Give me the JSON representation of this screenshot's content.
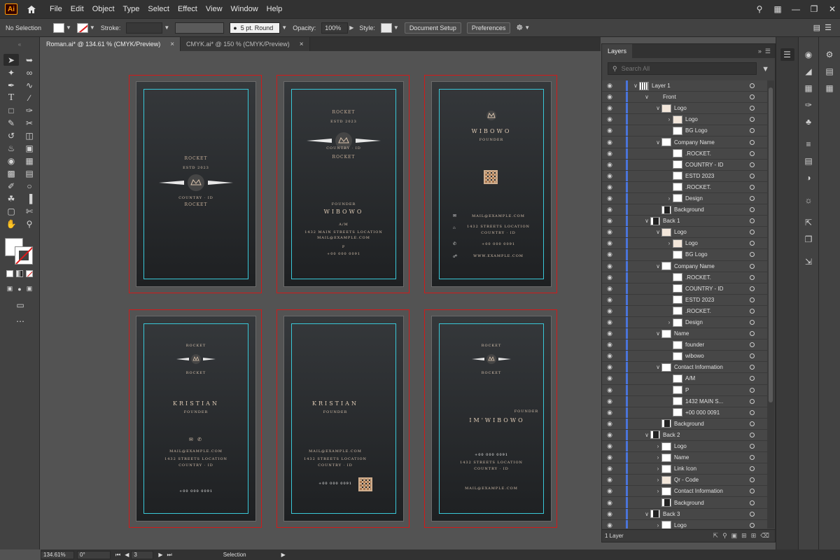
{
  "menu": [
    "File",
    "Edit",
    "Object",
    "Type",
    "Select",
    "Effect",
    "View",
    "Window",
    "Help"
  ],
  "app_logo": "Ai",
  "control": {
    "selection": "No Selection",
    "stroke_label": "Stroke:",
    "brush": "5 pt. Round",
    "opacity_label": "Opacity:",
    "opacity_value": "100%",
    "style_label": "Style:",
    "doc_setup": "Document Setup",
    "preferences": "Preferences"
  },
  "tabs": [
    {
      "label": "Roman.ai* @ 134.61 % (CMYK/Preview)",
      "active": true
    },
    {
      "label": "CMYK.ai* @ 150 % (CMYK/Preview)",
      "active": false
    }
  ],
  "cards": {
    "rocket": "ROCKET",
    "estd": "ESTD 2023",
    "country": "COUNTRY · ID",
    "founder": "FOUNDER",
    "wibowo": "WIBOWO",
    "am": "A/M",
    "address": "1432 MAIN STREETS LOCATION",
    "mail": "MAIL@EXAMPLE.COM",
    "p": "P",
    "phone": "+00 000 0091",
    "web": "WWW.EXAMPLE.COM",
    "street": "1432 STREETS LOCATION",
    "country_id": "COUNTRY · ID",
    "kristian": "KRISTIAN",
    "im_wibowo": "IM'WIBOWO"
  },
  "layers_panel": {
    "title": "Layers",
    "search_placeholder": "Search All",
    "footer_count": "1 Layer",
    "rows": [
      {
        "label": "Layer 1",
        "depth": 0,
        "tw": "v",
        "thumb": "grid"
      },
      {
        "label": "Front",
        "depth": 1,
        "tw": "v",
        "thumb": "none"
      },
      {
        "label": "Logo",
        "depth": 2,
        "tw": "v",
        "thumb": "logo"
      },
      {
        "label": "Logo",
        "depth": 3,
        "tw": ">",
        "thumb": "logo"
      },
      {
        "label": "BG Logo",
        "depth": 3,
        "tw": "",
        "thumb": "white"
      },
      {
        "label": "Company Name",
        "depth": 2,
        "tw": "v",
        "thumb": "white"
      },
      {
        "label": ".ROCKET.",
        "depth": 3,
        "tw": "",
        "thumb": "white"
      },
      {
        "label": "COUNTRY - ID",
        "depth": 3,
        "tw": "",
        "thumb": "white"
      },
      {
        "label": "ESTD 2023",
        "depth": 3,
        "tw": "",
        "thumb": "white"
      },
      {
        "label": ".ROCKET.",
        "depth": 3,
        "tw": "",
        "thumb": "white"
      },
      {
        "label": "Design",
        "depth": 3,
        "tw": ">",
        "thumb": "white"
      },
      {
        "label": "Background",
        "depth": 2,
        "tw": "",
        "thumb": "dark"
      },
      {
        "label": "Back 1",
        "depth": 1,
        "tw": "v",
        "thumb": "dark"
      },
      {
        "label": "Logo",
        "depth": 2,
        "tw": "v",
        "thumb": "logo"
      },
      {
        "label": "Logo",
        "depth": 3,
        "tw": ">",
        "thumb": "logo"
      },
      {
        "label": "BG Logo",
        "depth": 3,
        "tw": "",
        "thumb": "white"
      },
      {
        "label": "Company Name",
        "depth": 2,
        "tw": "v",
        "thumb": "white"
      },
      {
        "label": ".ROCKET.",
        "depth": 3,
        "tw": "",
        "thumb": "white"
      },
      {
        "label": "COUNTRY - ID",
        "depth": 3,
        "tw": "",
        "thumb": "white"
      },
      {
        "label": "ESTD 2023",
        "depth": 3,
        "tw": "",
        "thumb": "white"
      },
      {
        "label": ".ROCKET.",
        "depth": 3,
        "tw": "",
        "thumb": "white"
      },
      {
        "label": "Design",
        "depth": 3,
        "tw": ">",
        "thumb": "white"
      },
      {
        "label": "Name",
        "depth": 2,
        "tw": "v",
        "thumb": "white"
      },
      {
        "label": "founder",
        "depth": 3,
        "tw": "",
        "thumb": "white"
      },
      {
        "label": "wibowo",
        "depth": 3,
        "tw": "",
        "thumb": "white"
      },
      {
        "label": "Contact Information",
        "depth": 2,
        "tw": "v",
        "thumb": "white"
      },
      {
        "label": "A/M",
        "depth": 3,
        "tw": "",
        "thumb": "white"
      },
      {
        "label": "P",
        "depth": 3,
        "tw": "",
        "thumb": "white"
      },
      {
        "label": "1432 MAIN S...",
        "depth": 3,
        "tw": "",
        "thumb": "white"
      },
      {
        "label": "+00 000 0091",
        "depth": 3,
        "tw": "",
        "thumb": "white"
      },
      {
        "label": "Background",
        "depth": 2,
        "tw": "",
        "thumb": "dark"
      },
      {
        "label": "Back 2",
        "depth": 1,
        "tw": "v",
        "thumb": "dark"
      },
      {
        "label": "Logo",
        "depth": 2,
        "tw": ">",
        "thumb": "white"
      },
      {
        "label": "Name",
        "depth": 2,
        "tw": ">",
        "thumb": "white"
      },
      {
        "label": "Link Icon",
        "depth": 2,
        "tw": ">",
        "thumb": "white"
      },
      {
        "label": "Qr - Code",
        "depth": 2,
        "tw": ">",
        "thumb": "logo"
      },
      {
        "label": "Contact Information",
        "depth": 2,
        "tw": ">",
        "thumb": "white"
      },
      {
        "label": "Background",
        "depth": 2,
        "tw": "",
        "thumb": "dark"
      },
      {
        "label": "Back 3",
        "depth": 1,
        "tw": "v",
        "thumb": "dark"
      },
      {
        "label": "Logo",
        "depth": 2,
        "tw": ">",
        "thumb": "white"
      }
    ]
  },
  "status": {
    "zoom": "134.61%",
    "rotation": "0°",
    "artboard": "3",
    "mode": "Selection"
  }
}
